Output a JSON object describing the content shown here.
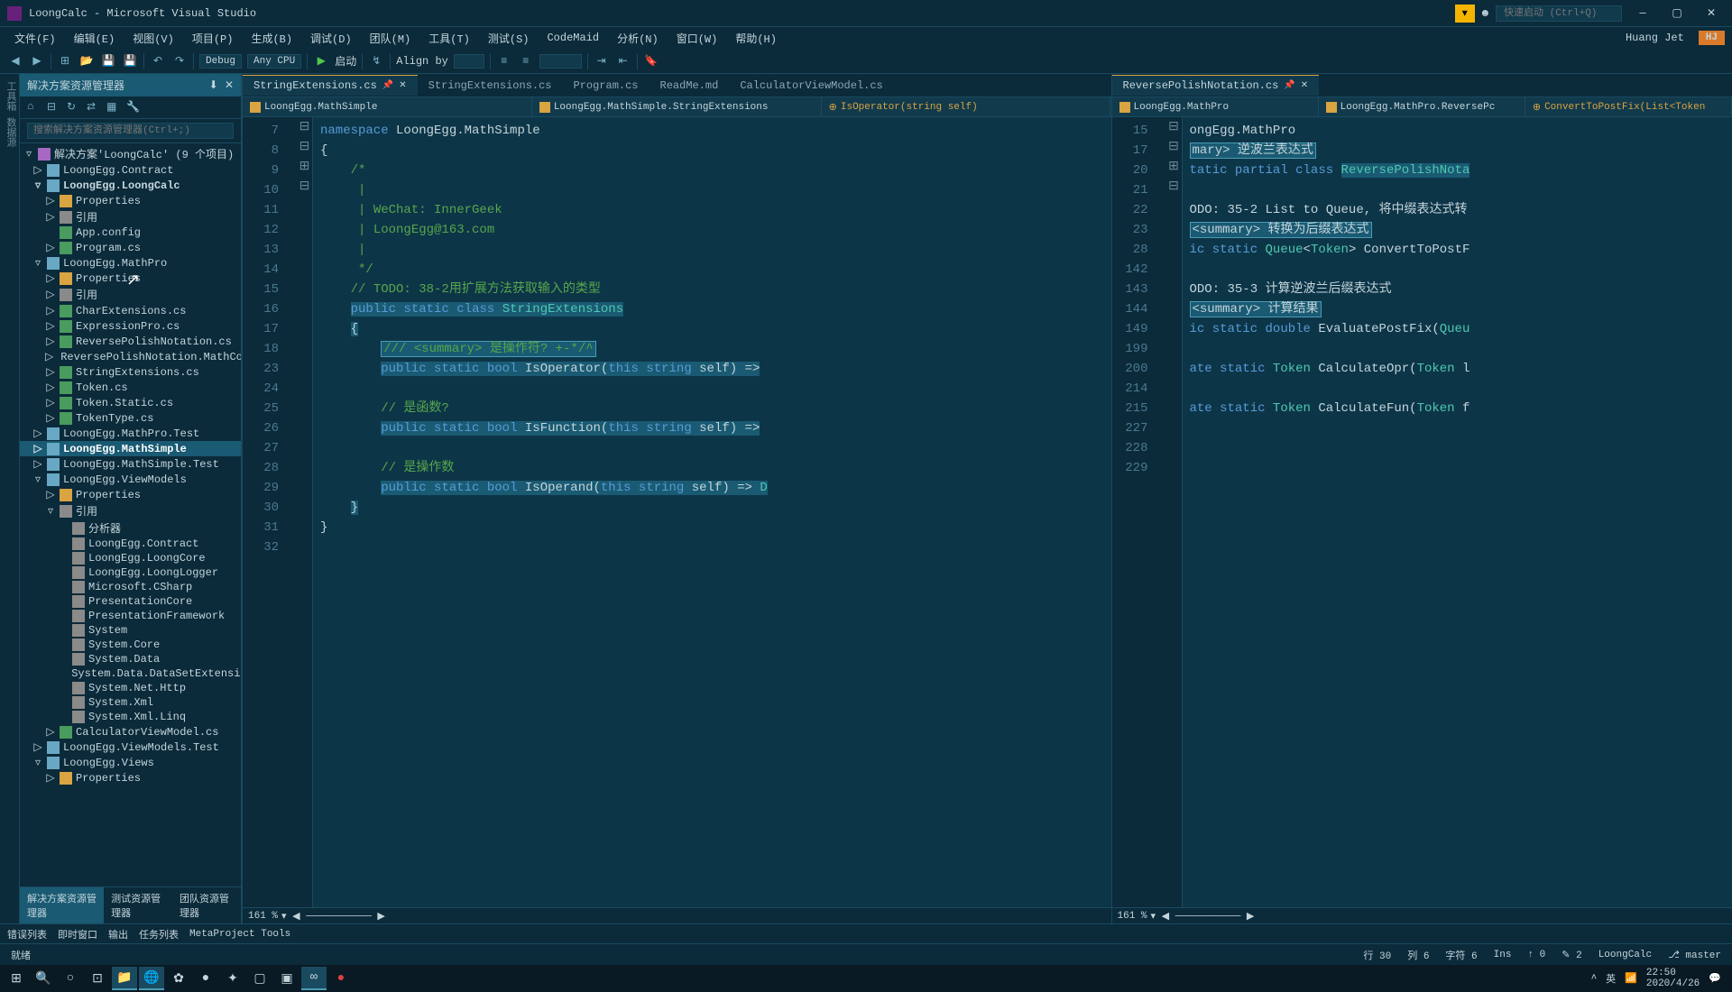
{
  "title": "LoongCalc - Microsoft Visual Studio",
  "quick_launch": "快速启动 (Ctrl+Q)",
  "user_name": "Huang Jet",
  "user_badge": "HJ",
  "menu": [
    "文件(F)",
    "编辑(E)",
    "视图(V)",
    "项目(P)",
    "生成(B)",
    "调试(D)",
    "团队(M)",
    "工具(T)",
    "测试(S)",
    "CodeMaid",
    "分析(N)",
    "窗口(W)",
    "帮助(H)"
  ],
  "toolbar": {
    "config": "Debug",
    "platform": "Any CPU",
    "start": "启动",
    "alignby": "Align by"
  },
  "solution": {
    "panel_title": "解决方案资源管理器",
    "search_ph": "搜索解决方案资源管理器(Ctrl+;)",
    "root": "解决方案'LoongCalc' (9 个项目)",
    "items": [
      {
        "t": "LoongEgg.Contract",
        "d": 1,
        "exp": "▷",
        "ic": "proj"
      },
      {
        "t": "LoongEgg.LoongCalc",
        "d": 1,
        "exp": "▿",
        "ic": "proj",
        "b": true
      },
      {
        "t": "Properties",
        "d": 2,
        "exp": "▷",
        "ic": "folder"
      },
      {
        "t": "引用",
        "d": 2,
        "exp": "▷",
        "ic": "ref"
      },
      {
        "t": "App.config",
        "d": 2,
        "exp": "",
        "ic": "cs"
      },
      {
        "t": "Program.cs",
        "d": 2,
        "exp": "▷",
        "ic": "cs"
      },
      {
        "t": "LoongEgg.MathPro",
        "d": 1,
        "exp": "▿",
        "ic": "proj"
      },
      {
        "t": "Properties",
        "d": 2,
        "exp": "▷",
        "ic": "folder"
      },
      {
        "t": "引用",
        "d": 2,
        "exp": "▷",
        "ic": "ref"
      },
      {
        "t": "CharExtensions.cs",
        "d": 2,
        "exp": "▷",
        "ic": "cs"
      },
      {
        "t": "ExpressionPro.cs",
        "d": 2,
        "exp": "▷",
        "ic": "cs"
      },
      {
        "t": "ReversePolishNotation.cs",
        "d": 2,
        "exp": "▷",
        "ic": "cs"
      },
      {
        "t": "ReversePolishNotation.MathCore.cs",
        "d": 2,
        "exp": "▷",
        "ic": "cs"
      },
      {
        "t": "StringExtensions.cs",
        "d": 2,
        "exp": "▷",
        "ic": "cs"
      },
      {
        "t": "Token.cs",
        "d": 2,
        "exp": "▷",
        "ic": "cs"
      },
      {
        "t": "Token.Static.cs",
        "d": 2,
        "exp": "▷",
        "ic": "cs"
      },
      {
        "t": "TokenType.cs",
        "d": 2,
        "exp": "▷",
        "ic": "cs"
      },
      {
        "t": "LoongEgg.MathPro.Test",
        "d": 1,
        "exp": "▷",
        "ic": "proj"
      },
      {
        "t": "LoongEgg.MathSimple",
        "d": 1,
        "exp": "▷",
        "ic": "proj",
        "sel": true,
        "b": true
      },
      {
        "t": "LoongEgg.MathSimple.Test",
        "d": 1,
        "exp": "▷",
        "ic": "proj"
      },
      {
        "t": "LoongEgg.ViewModels",
        "d": 1,
        "exp": "▿",
        "ic": "proj"
      },
      {
        "t": "Properties",
        "d": 2,
        "exp": "▷",
        "ic": "folder"
      },
      {
        "t": "引用",
        "d": 2,
        "exp": "▿",
        "ic": "ref"
      },
      {
        "t": "分析器",
        "d": 3,
        "exp": "",
        "ic": "ref"
      },
      {
        "t": "LoongEgg.Contract",
        "d": 3,
        "exp": "",
        "ic": "ref"
      },
      {
        "t": "LoongEgg.LoongCore",
        "d": 3,
        "exp": "",
        "ic": "ref"
      },
      {
        "t": "LoongEgg.LoongLogger",
        "d": 3,
        "exp": "",
        "ic": "ref"
      },
      {
        "t": "Microsoft.CSharp",
        "d": 3,
        "exp": "",
        "ic": "ref"
      },
      {
        "t": "PresentationCore",
        "d": 3,
        "exp": "",
        "ic": "ref"
      },
      {
        "t": "PresentationFramework",
        "d": 3,
        "exp": "",
        "ic": "ref"
      },
      {
        "t": "System",
        "d": 3,
        "exp": "",
        "ic": "ref"
      },
      {
        "t": "System.Core",
        "d": 3,
        "exp": "",
        "ic": "ref"
      },
      {
        "t": "System.Data",
        "d": 3,
        "exp": "",
        "ic": "ref"
      },
      {
        "t": "System.Data.DataSetExtensions",
        "d": 3,
        "exp": "",
        "ic": "ref"
      },
      {
        "t": "System.Net.Http",
        "d": 3,
        "exp": "",
        "ic": "ref"
      },
      {
        "t": "System.Xml",
        "d": 3,
        "exp": "",
        "ic": "ref"
      },
      {
        "t": "System.Xml.Linq",
        "d": 3,
        "exp": "",
        "ic": "ref"
      },
      {
        "t": "CalculatorViewModel.cs",
        "d": 2,
        "exp": "▷",
        "ic": "cs"
      },
      {
        "t": "LoongEgg.ViewModels.Test",
        "d": 1,
        "exp": "▷",
        "ic": "proj"
      },
      {
        "t": "LoongEgg.Views",
        "d": 1,
        "exp": "▿",
        "ic": "proj"
      },
      {
        "t": "Properties",
        "d": 2,
        "exp": "▷",
        "ic": "folder"
      }
    ],
    "bottom_tabs": [
      "解决方案资源管理器",
      "测试资源管理器",
      "团队资源管理器"
    ]
  },
  "tabs_left": [
    {
      "label": "StringExtensions.cs",
      "active": true,
      "pinned": true
    },
    {
      "label": "StringExtensions.cs"
    },
    {
      "label": "Program.cs"
    },
    {
      "label": "ReadMe.md"
    },
    {
      "label": "CalculatorViewModel.cs"
    }
  ],
  "tabs_right": [
    {
      "label": "ReversePolishNotation.cs",
      "active": true,
      "pinned": true
    }
  ],
  "nav_left": [
    "LoongEgg.MathSimple",
    "LoongEgg.MathSimple.StringExtensions",
    "IsOperator(string self)"
  ],
  "nav_right": [
    "LoongEgg.MathPro",
    "LoongEgg.MathPro.ReversePc",
    "ConvertToPostFix(List<Token"
  ],
  "code_left": {
    "lines": [
      7,
      8,
      9,
      10,
      11,
      12,
      13,
      14,
      15,
      16,
      17,
      18,
      23,
      24,
      25,
      26,
      27,
      28,
      29,
      30,
      31,
      32
    ],
    "body": [
      "<span class='kw'>namespace</span> LoongEgg.MathSimple",
      "{",
      "    <span class='cmt'>/*</span>",
      "    <span class='cmt'> |</span>",
      "    <span class='cmt'> | WeChat: InnerGeek</span>",
      "    <span class='cmt'> | LoongEgg@163.com</span>",
      "    <span class='cmt'> |</span>",
      "    <span class='cmt'> */</span>",
      "    <span class='cmt'>// TODO: 38-2用扩展方法获取输入的类型</span>",
      "    <span class='hlbg'><span class='kw'>public</span> <span class='kw'>static</span> <span class='kw'>class</span> <span class='cls'>StringExtensions</span></span>",
      "    <span class='hlbg'>{</span>",
      "        <span class='hlbox'><span class='doc'>/// &lt;summary&gt; 是操作符? +-*/^</span></span>",
      "        <span class='hlbg'><span class='kw'>public</span> <span class='kw'>static</span> <span class='kw'>bool</span> IsOperator(<span class='kw'>this</span> <span class='kw'>string</span> self) =&gt;</span>",
      "",
      "        <span class='cmt'>// 是函数?</span>",
      "        <span class='hlbg'><span class='kw'>public</span> <span class='kw'>static</span> <span class='kw'>bool</span> IsFunction(<span class='kw'>this</span> <span class='kw'>string</span> self) =&gt;</span>",
      "",
      "        <span class='cmt'>// 是操作数</span>",
      "        <span class='hlbg'><span class='kw'>public</span> <span class='kw'>static</span> <span class='kw'>bool</span> IsOperand(<span class='kw'>this</span> <span class='kw'>string</span> self) =&gt; <span class='cls'>D</span></span>",
      "    <span class='hlbg'>}</span>",
      "}",
      ""
    ]
  },
  "code_right": {
    "lines": [
      15,
      17,
      20,
      21,
      22,
      23,
      28,
      142,
      143,
      144,
      149,
      199,
      200,
      214,
      215,
      227,
      228,
      229
    ],
    "body": [
      "ongEgg.MathPro",
      "<span class='hlbox'>mary&gt; 逆波兰表达式</span>",
      "<span class='kw'>tatic partial class</span> <span class='cls hlbg'>ReversePolishNota</span>",
      "",
      "ODO: 35-2 List to Queue, 将中缀表达式转",
      "<span class='hlbox'>&lt;summary&gt; 转换为后缀表达式</span>",
      "<span class='kw'>ic static</span> <span class='cls'>Queue</span>&lt;<span class='cls'>Token</span>&gt; ConvertToPostF",
      "",
      "ODO: 35-3 计算逆波兰后缀表达式",
      "<span class='hlbox'>&lt;summary&gt; 计算结果</span>",
      "<span class='kw'>ic static double</span> EvaluatePostFix(<span class='cls'>Queu</span>",
      "",
      "<span class='kw'>ate static</span> <span class='cls'>Token</span> CalculateOpr(<span class='cls'>Token</span> l",
      "",
      "<span class='kw'>ate static</span> <span class='cls'>Token</span> CalculateFun(<span class='cls'>Token</span> f",
      "",
      "",
      ""
    ]
  },
  "zoom": "161 %",
  "bottom_tool_tabs": [
    "错误列表",
    "即时窗口",
    "输出",
    "任务列表",
    "MetaProject Tools"
  ],
  "status": {
    "ready": "就绪",
    "line": "行 30",
    "col": "列 6",
    "char": "字符 6",
    "ins": "Ins",
    "up": "0",
    "down": "2",
    "repo": "LoongCalc",
    "branch": "master"
  },
  "taskbar": {
    "time": "22:50",
    "date": "2020/4/26",
    "lang": "英",
    "wifi": "📶"
  }
}
